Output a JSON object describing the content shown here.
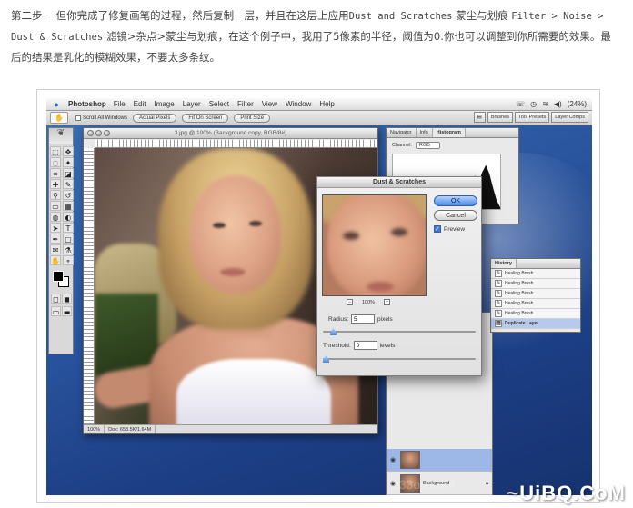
{
  "article": {
    "line1": "第二步 一但你完成了修复画笔的过程，然后复制一层，并且在这层上应用",
    "filter_en": "Dust and Scratches",
    "line1b": "蒙尘与划痕",
    "menu_path_en": "Filter > Noise >",
    "line2_en": "Dust & Scratches",
    "line2": "滤镜>杂点>蒙尘与划痕，在这个例子中，我用了5像素的半径，阈值为0.你也可以调整到你所需要的效果。最",
    "line3": "后的结果是乳化的模糊效果，不要太多条纹。"
  },
  "menubar": {
    "app": "Photoshop",
    "items": [
      "File",
      "Edit",
      "Image",
      "Layer",
      "Select",
      "Filter",
      "View",
      "Window",
      "Help"
    ],
    "battery": "(24%)"
  },
  "options": {
    "scroll_all": "Scroll All Windows",
    "buttons": [
      "Actual Pixels",
      "Fit On Screen",
      "Print Size"
    ],
    "wells": [
      "Brushes",
      "Tool Presets",
      "Layer Comps"
    ]
  },
  "document": {
    "title": "3.jpg @ 100% (Background copy, RGB/8#)",
    "zoom": "100%",
    "doc_info": "Doc: 658.5K/1.64M"
  },
  "nav_panel": {
    "tabs": [
      "Navigator",
      "Info",
      "Histogram"
    ],
    "active_tab": "Histogram",
    "channel_label": "Channel:",
    "channel_value": "RGB"
  },
  "history_panel": {
    "tab": "History",
    "items": [
      "Healing Brush",
      "Healing Brush",
      "Healing Brush",
      "Healing Brush",
      "Healing Brush",
      "Duplicate Layer"
    ]
  },
  "layers_panel": {
    "background_label": "Background"
  },
  "dialog": {
    "title": "Dust & Scratches",
    "ok": "OK",
    "cancel": "Cancel",
    "preview_label": "Preview",
    "preview_checked": true,
    "zoom": "100%",
    "radius_label": "Radius:",
    "radius_value": "5",
    "radius_unit": "pixels",
    "radius_slider_fraction": 0.05,
    "threshold_label": "Threshold:",
    "threshold_value": "0",
    "threshold_unit": "levels",
    "threshold_slider_fraction": 0.0
  },
  "watermark": {
    "site": "UiBQ.CoM",
    "prefix": "~",
    "faint": "333op.com"
  }
}
